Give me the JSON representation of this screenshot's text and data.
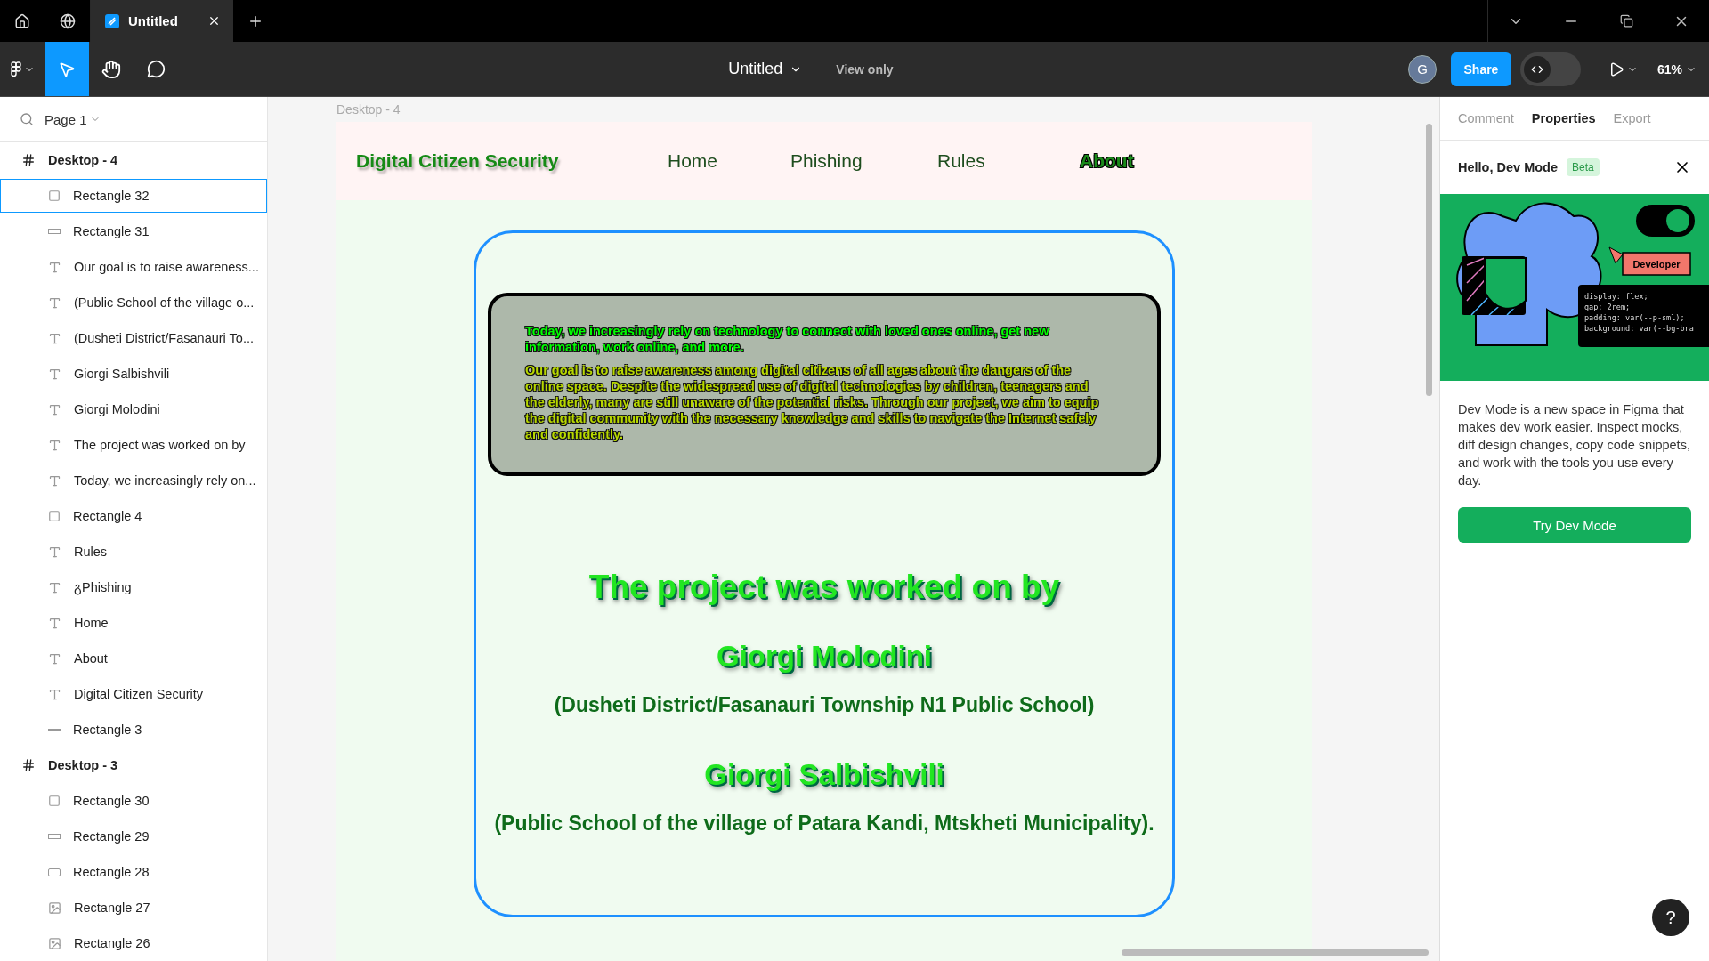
{
  "tabs_bar": {
    "tabs": [
      {
        "title": "Untitled",
        "selected": true
      }
    ]
  },
  "toolbar": {
    "tools": [
      {
        "kind": "move",
        "selected": true
      },
      {
        "kind": "hand",
        "selected": false
      },
      {
        "kind": "comment",
        "selected": false
      }
    ],
    "file_title": "Untitled",
    "mode": "View only",
    "avatar": "G",
    "share": "Share",
    "dev_mode_on": false,
    "zoom": "61%"
  },
  "layers": {
    "page": "Page 1",
    "items": [
      {
        "kind": "frame",
        "name": "Desktop - 4",
        "selected": false,
        "children": [
          {
            "kind": "rect",
            "name": "Rectangle 32",
            "selected": true
          },
          {
            "kind": "bar",
            "name": "Rectangle 31",
            "selected": false
          },
          {
            "kind": "text",
            "name": "Our goal is to raise awareness...",
            "selected": false
          },
          {
            "kind": "text",
            "name": "(Public School of the village o...",
            "selected": false
          },
          {
            "kind": "text",
            "name": "(Dusheti District/Fasanauri To...",
            "selected": false
          },
          {
            "kind": "text",
            "name": "Giorgi Salbishvili",
            "selected": false
          },
          {
            "kind": "text",
            "name": "Giorgi Molodini",
            "selected": false
          },
          {
            "kind": "text",
            "name": "The project was worked on by",
            "selected": false
          },
          {
            "kind": "text",
            "name": "Today, we increasingly rely on...",
            "selected": false
          },
          {
            "kind": "rect",
            "name": "Rectangle 4",
            "selected": false
          },
          {
            "kind": "text",
            "name": "Rules",
            "selected": false
          },
          {
            "kind": "text",
            "name": "გPhishing",
            "selected": false
          },
          {
            "kind": "text",
            "name": "Home",
            "selected": false
          },
          {
            "kind": "text",
            "name": "About",
            "selected": false
          },
          {
            "kind": "text",
            "name": "Digital Citizen Security",
            "selected": false
          },
          {
            "kind": "line",
            "name": "Rectangle 3",
            "selected": false
          }
        ]
      },
      {
        "kind": "frame",
        "name": "Desktop - 3",
        "selected": false,
        "children": [
          {
            "kind": "rect",
            "name": "Rectangle 30",
            "selected": false
          },
          {
            "kind": "bar",
            "name": "Rectangle 29",
            "selected": false
          },
          {
            "kind": "box",
            "name": "Rectangle 28",
            "selected": false
          },
          {
            "kind": "image",
            "name": "Rectangle 27",
            "selected": false
          },
          {
            "kind": "image",
            "name": "Rectangle 26",
            "selected": false
          }
        ]
      }
    ]
  },
  "canvas": {
    "frame_label": "Desktop - 4",
    "site": {
      "brand": "Digital Citizen Security",
      "nav": [
        {
          "label": "Home",
          "selected": false
        },
        {
          "label": "Phishing",
          "selected": false
        },
        {
          "label": "Rules",
          "selected": false
        },
        {
          "label": "About",
          "selected": true
        }
      ],
      "intro": "Today, we increasingly rely on technology to connect with loved ones online, get new information, work online, and more.",
      "goal": "Our goal is to raise awareness among digital citizens of all ages about the dangers of the online space. Despite the widespread use of digital technologies by children, teenagers and the elderly, many are still unaware of the potential risks. Through our project, we aim to equip the digital community with the necessary knowledge and skills to navigate the Internet safely and confidently.",
      "heading": "The project was worked on by",
      "authors": [
        {
          "name": "Giorgi Molodini",
          "school": "(Dusheti District/Fasanauri Township N1 Public School)"
        },
        {
          "name": "Giorgi Salbishvili",
          "school": "(Public School of the village of Patara Kandi, Mtskheti Municipality)."
        }
      ]
    }
  },
  "inspector": {
    "tabs": [
      {
        "label": "Comment",
        "selected": false
      },
      {
        "label": "Properties",
        "selected": true
      },
      {
        "label": "Export",
        "selected": false
      }
    ],
    "title": "Hello, Dev Mode",
    "badge": "Beta",
    "illustration": {
      "label": "Developer",
      "code": [
        "display: flex;",
        "gap: 2rem;",
        "padding: var(--p-sml);",
        "background: var(--bg-bra"
      ]
    },
    "description": "Dev Mode is a new space in Figma that makes dev work easier. Inspect mocks, diff design changes, copy code snippets, and work with the tools you use every day.",
    "button": "Try Dev Mode"
  },
  "help": "?"
}
